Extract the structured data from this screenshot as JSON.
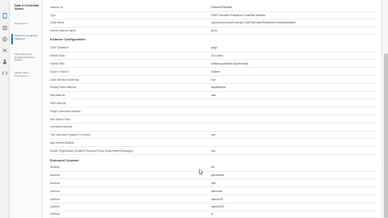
{
  "nav": {
    "title": "Data & Credential Stores",
    "items": [
      {
        "label": "Data Stores"
      },
      {
        "label": "Password Credential Validators"
      },
      {
        "label": "Active Directory Domains/Kerberos Realms"
      },
      {
        "label": "Identity Store Provisioners"
      }
    ]
  },
  "rail_icons": [
    "document-icon",
    "list-icon",
    "gear-icon",
    "link-icon",
    "people-icon",
    "bell-icon",
    "code-icon"
  ],
  "top_rows": [
    {
      "key": "Instance ID",
      "value": "PasswordValidator"
    },
    {
      "key": "Type",
      "value": "LDAP Username Password Credential Validator"
    },
    {
      "key": "Class Name",
      "value": "org.sourceid.saml20.domain.LDAPUsernamePasswordCredentialValidator"
    },
    {
      "key": "Parent Instance Name",
      "value": "None"
    }
  ],
  "instance_configuration": {
    "title": "Instance Configuration",
    "rows": [
      {
        "key": "LDAP Datastore",
        "value": "pingo"
      },
      {
        "key": "Search Base",
        "value": "OU=Users"
      },
      {
        "key": "Search Filter",
        "value": "sAMAccountName=${username}"
      },
      {
        "key": "Scope of Search",
        "value": "Subtree"
      },
      {
        "key": "Case-Sensitive Matching",
        "value": "true"
      },
      {
        "key": "Display Name Attribute",
        "value": "displayName"
      },
      {
        "key": "Mail Attribute",
        "value": "mail"
      },
      {
        "key": "SMS Attribute",
        "value": ""
      },
      {
        "key": "PingID Username Attribute",
        "value": ""
      },
      {
        "key": "Mail Search Filter",
        "value": ""
      },
      {
        "key": "Username Attribute",
        "value": ""
      },
      {
        "key": "Trim Username Spaces For Search",
        "value": "true"
      },
      {
        "key": "Mail Verified Attribute",
        "value": ""
      },
      {
        "key": "Enable PingDirectory Detailed Password Policy Requirement Messaging",
        "value": "true"
      }
    ]
  },
  "extended_contract": {
    "title": "Extended Contract",
    "rows": [
      {
        "key": "Attribute",
        "value": "DN"
      },
      {
        "key": "Attribute",
        "value": "givenName"
      },
      {
        "key": "Attribute",
        "value": "mail"
      },
      {
        "key": "Attribute",
        "value": "username"
      },
      {
        "key": "Attribute",
        "value": "memberOf"
      },
      {
        "key": "Attribute",
        "value": "objectGUID"
      },
      {
        "key": "Attribute",
        "value": "cn"
      }
    ]
  }
}
